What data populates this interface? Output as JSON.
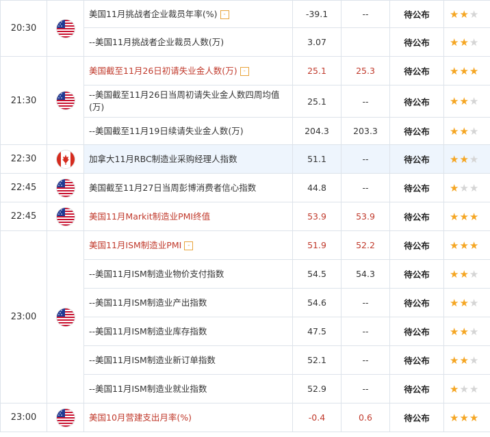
{
  "status_label": "待公布",
  "rows": [
    {
      "time": "20:30",
      "country": "us",
      "name": "美国11月挑战者企业裁员年率(%)",
      "badge": "-",
      "actual": "-39.1",
      "forecast": "--",
      "stars": 2,
      "red": false
    },
    {
      "time": "",
      "country": "",
      "name": "--美国11月挑战者企业裁员人数(万)",
      "badge": "",
      "actual": "3.07",
      "forecast": "",
      "stars": 2,
      "red": false
    },
    {
      "time": "21:30",
      "country": "us",
      "name": "美国截至11月26日初请失业金人数(万)",
      "badge": "-",
      "actual": "25.1",
      "forecast": "25.3",
      "stars": 3,
      "red": true
    },
    {
      "time": "",
      "country": "",
      "name": "--美国截至11月26日当周初请失业金人数四周均值(万)",
      "badge": "",
      "actual": "25.1",
      "forecast": "--",
      "stars": 2,
      "red": false
    },
    {
      "time": "",
      "country": "",
      "name": "--美国截至11月19日续请失业金人数(万)",
      "badge": "",
      "actual": "204.3",
      "forecast": "203.3",
      "stars": 2,
      "red": false
    },
    {
      "time": "22:30",
      "country": "ca",
      "name": "加拿大11月RBC制造业采购经理人指数",
      "badge": "",
      "actual": "51.1",
      "forecast": "--",
      "stars": 2,
      "red": false
    },
    {
      "time": "22:45",
      "country": "us",
      "name": "美国截至11月27日当周彭博消费者信心指数",
      "badge": "",
      "actual": "44.8",
      "forecast": "--",
      "stars": 1,
      "red": false
    },
    {
      "time": "22:45",
      "country": "us",
      "name": "美国11月Markit制造业PMI终值",
      "badge": "",
      "actual": "53.9",
      "forecast": "53.9",
      "stars": 3,
      "red": true
    },
    {
      "time": "23:00",
      "country": "us",
      "name": "美国11月ISM制造业PMI",
      "badge": "-",
      "actual": "51.9",
      "forecast": "52.2",
      "stars": 3,
      "red": true
    },
    {
      "time": "",
      "country": "",
      "name": "--美国11月ISM制造业物价支付指数",
      "badge": "",
      "actual": "54.5",
      "forecast": "54.3",
      "stars": 2,
      "red": false
    },
    {
      "time": "",
      "country": "",
      "name": "--美国11月ISM制造业产出指数",
      "badge": "",
      "actual": "54.6",
      "forecast": "--",
      "stars": 2,
      "red": false
    },
    {
      "time": "",
      "country": "",
      "name": "--美国11月ISM制造业库存指数",
      "badge": "",
      "actual": "47.5",
      "forecast": "--",
      "stars": 2,
      "red": false
    },
    {
      "time": "",
      "country": "",
      "name": "--美国11月ISM制造业新订单指数",
      "badge": "",
      "actual": "52.1",
      "forecast": "--",
      "stars": 2,
      "red": false
    },
    {
      "time": "",
      "country": "",
      "name": "--美国11月ISM制造业就业指数",
      "badge": "",
      "actual": "52.9",
      "forecast": "--",
      "stars": 1,
      "red": false
    },
    {
      "time": "23:00",
      "country": "us",
      "name": "美国10月营建支出月率(%)",
      "badge": "",
      "actual": "-0.4",
      "forecast": "0.6",
      "stars": 3,
      "red": true
    }
  ],
  "colors": {
    "red": "#c0392b",
    "star_on": "#f5a623",
    "star_off": "#d5d5d5",
    "highlight": "#eef5fd"
  }
}
